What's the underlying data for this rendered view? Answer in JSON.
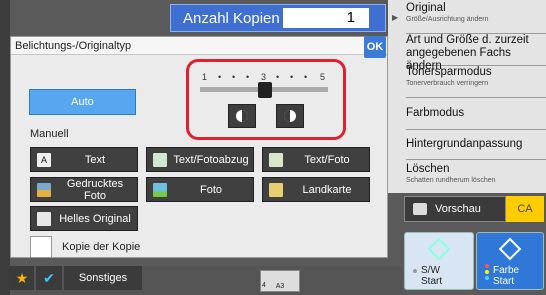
{
  "copies": {
    "label": "Anzahl Kopien",
    "value": "1"
  },
  "right_menu": [
    {
      "title": "Original",
      "subtitle": "Größe/Ausrichtung ändern"
    },
    {
      "title": "Art und Größe d. zurzeit angegebenen Fachs ändern",
      "subtitle": ""
    },
    {
      "title": "Tonersparmodus",
      "subtitle": "Tonerverbrauch verringern"
    },
    {
      "title": "Farbmodus",
      "subtitle": ""
    },
    {
      "title": "Hintergrundanpassung",
      "subtitle": ""
    },
    {
      "title": "Löschen",
      "subtitle": "Schatten rundherum löschen"
    }
  ],
  "dialog": {
    "title": "Belichtungs-/Originaltyp",
    "ok_label": "OK",
    "auto_label": "Auto",
    "manual_label": "Manuell",
    "mode_buttons": [
      {
        "label": "Text",
        "icon": "text-letter-icon",
        "thumb_color": "#f0f0f0"
      },
      {
        "label": "Text/Fotoabzug",
        "icon": "text-photo-print-icon",
        "thumb_color": "#cfe8cf"
      },
      {
        "label": "Text/Foto",
        "icon": "text-photo-icon",
        "thumb_color": "#d8e8c8"
      },
      {
        "label": "Gedrucktes Foto",
        "icon": "printed-photo-icon",
        "thumb_color": "#e4b040"
      },
      {
        "label": "Foto",
        "icon": "photo-icon",
        "thumb_color": "#6cc0e0"
      },
      {
        "label": "Landkarte",
        "icon": "map-icon",
        "thumb_color": "#e8d070"
      },
      {
        "label": "Helles Original",
        "icon": "light-original-icon",
        "thumb_color": "#e8e8e8"
      }
    ],
    "copy_of_copy_label": "Kopie der Kopie"
  },
  "exposure": {
    "scale_labels": [
      "1",
      "3",
      "5"
    ],
    "level": 3,
    "min": 1,
    "max": 5
  },
  "preview_label": "Vorschau",
  "ca_label": "CA",
  "start_bw": {
    "line1": "S/W",
    "line2": "Start"
  },
  "start_color": {
    "line1": "Farbe",
    "line2": "Start"
  },
  "bottom": {
    "other_label": "Sonstiges",
    "tray_size": "A3",
    "tray_num": "4"
  },
  "colors": {
    "accent_blue": "#3b7ad8",
    "highlight_red": "#e02030",
    "ca_yellow": "#ffcc00"
  }
}
